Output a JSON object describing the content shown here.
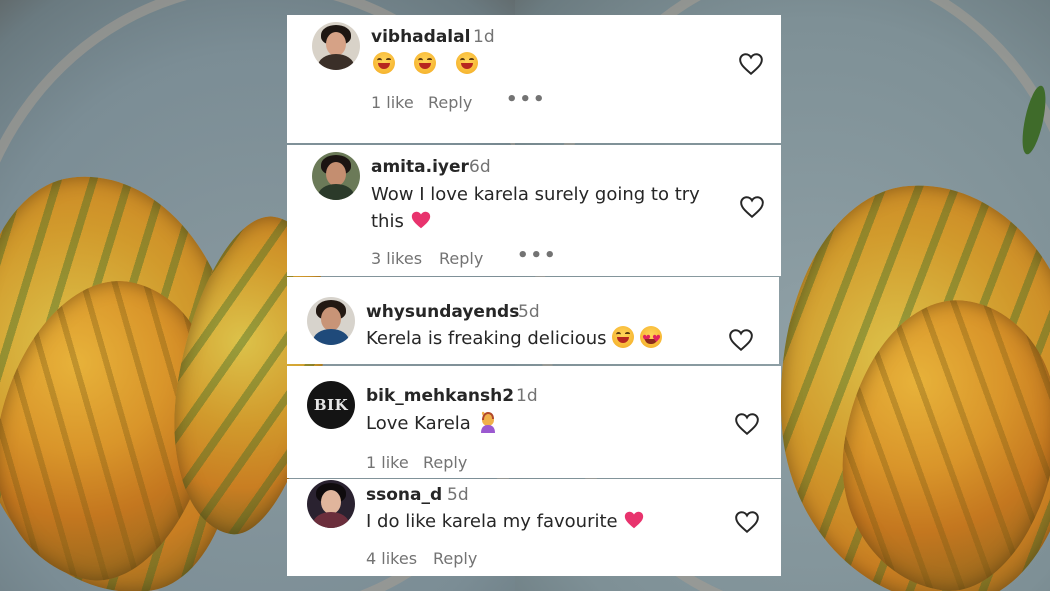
{
  "comments": [
    {
      "username": "vibhadalal",
      "age": "1d",
      "text": "",
      "emojis": [
        "smiling-face-emoji",
        "smiling-face-emoji",
        "smiling-face-emoji"
      ],
      "likes": "1 like",
      "reply": "Reply",
      "more": "•••"
    },
    {
      "username": "amita.iyer",
      "age": "6d",
      "text_line1": "Wow I love karela surely going to try",
      "text_line2": "this",
      "emojis": [
        "pink-heart-emoji"
      ],
      "likes": "3 likes",
      "reply": "Reply",
      "more": "•••"
    },
    {
      "username": "whysundayends",
      "age": "5d",
      "text": "Kerela is freaking delicious",
      "emojis": [
        "smiling-face-emoji",
        "heart-eyes-emoji"
      ]
    },
    {
      "username": "bik_mehkansh2",
      "age": "1d",
      "avatar_text": "BIK",
      "text": "Love Karela",
      "emojis": [
        "person-raising-hand-emoji"
      ],
      "likes": "1 like",
      "reply": "Reply"
    },
    {
      "username": "ssona_d",
      "age": "5d",
      "text": "I do like karela my favourite",
      "emojis": [
        "pink-heart-emoji"
      ],
      "likes": "4 likes",
      "reply": "Reply"
    }
  ],
  "colors": {
    "username": "#262626",
    "secondary": "#737373",
    "card_bg": "#ffffff",
    "heart_stroke": "#262626",
    "pink_heart": "#e8336d"
  }
}
